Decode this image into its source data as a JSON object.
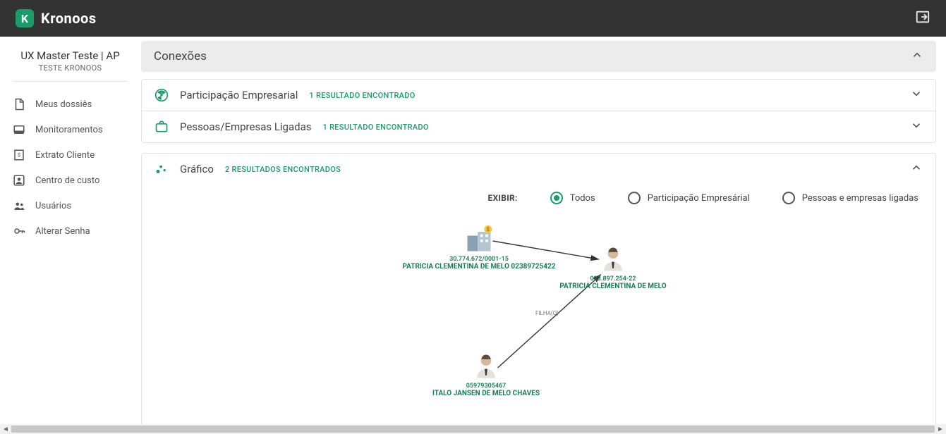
{
  "brand": {
    "name": "Kronoos",
    "logo_letter": "K"
  },
  "sidebar": {
    "title": "UX Master Teste | AP",
    "subtitle": "TESTE KRONOOS",
    "items": [
      {
        "label": "Meus dossiês",
        "icon": "file-icon"
      },
      {
        "label": "Monitoramentos",
        "icon": "monitor-icon"
      },
      {
        "label": "Extrato Cliente",
        "icon": "receipt-icon"
      },
      {
        "label": "Centro de custo",
        "icon": "account-icon"
      },
      {
        "label": "Usuários",
        "icon": "users-icon"
      },
      {
        "label": "Alterar Senha",
        "icon": "key-icon"
      }
    ]
  },
  "panel": {
    "title": "Conexões"
  },
  "cards": [
    {
      "icon": "radiation-icon",
      "title": "Participação Empresarial",
      "sub": "1 RESULTADO ENCONTRADO"
    },
    {
      "icon": "briefcase-icon",
      "title": "Pessoas/Empresas Ligadas",
      "sub": "1 RESULTADO ENCONTRADO"
    }
  ],
  "graph": {
    "icon": "scatter-icon",
    "title": "Gráfico",
    "sub": "2 RESULTADOS ENCONTRADOS",
    "filter_label": "EXIBIR:",
    "filters": [
      {
        "text": "Todos",
        "selected": true
      },
      {
        "text": "Participação Empresárial",
        "selected": false
      },
      {
        "text": "Pessoas e empresas ligadas",
        "selected": false
      }
    ],
    "nodes": {
      "company": {
        "type": "company",
        "id": "30.774.672/0001-15",
        "name": "PATRICIA CLEMENTINA DE MELO 02389725422"
      },
      "person1": {
        "type": "person",
        "id": "023.897.254-22",
        "name": "PATRICIA CLEMENTINA DE MELO"
      },
      "person2": {
        "type": "person",
        "id": "05979305467",
        "name": "ITALO JANSEN DE MELO CHAVES"
      }
    },
    "edges": [
      {
        "from": "company",
        "to": "person1",
        "label": ""
      },
      {
        "from": "person2",
        "to": "person1",
        "label": "FILHA(O)"
      }
    ]
  }
}
